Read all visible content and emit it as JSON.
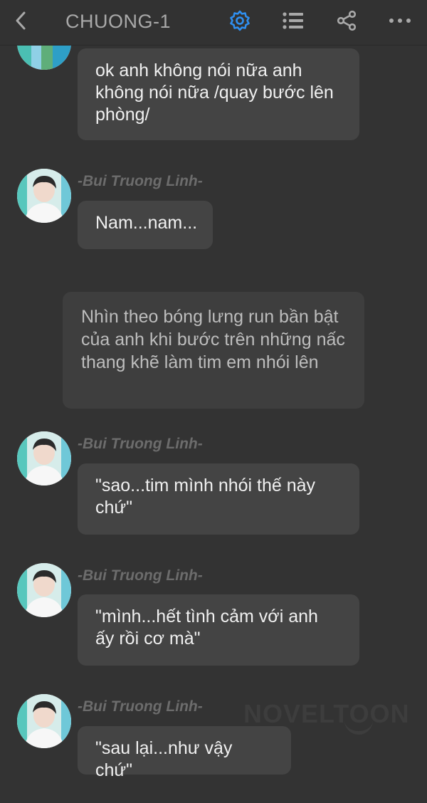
{
  "header": {
    "title": "CHUONG-1"
  },
  "icons": {
    "back": "chevron-left-icon",
    "settings": "gear-icon",
    "list": "list-icon",
    "share": "share-icon",
    "more": "more-icon",
    "accent": "#2f8ff0"
  },
  "chat": {
    "bubble_top": "ok anh không nói nữa anh không nói nữa /quay bước lên phòng/",
    "messages": [
      {
        "name": "-Bui Truong Linh-",
        "text": "Nam...nam..."
      },
      {
        "name": "-Bui Truong Linh-",
        "text": "\"sao...tim mình nhói thế này chứ\""
      },
      {
        "name": "-Bui Truong Linh-",
        "text": "\"mình...hết tình cảm với anh ấy rồi cơ mà\""
      },
      {
        "name": "-Bui Truong Linh-",
        "text": "\"sau lại...như vậy chứ\""
      }
    ],
    "narration": "Nhìn theo bóng lưng run bần bật của anh khi bước trên những nấc thang khẽ làm tim em nhói lên"
  },
  "watermark": "NOVELTOON"
}
